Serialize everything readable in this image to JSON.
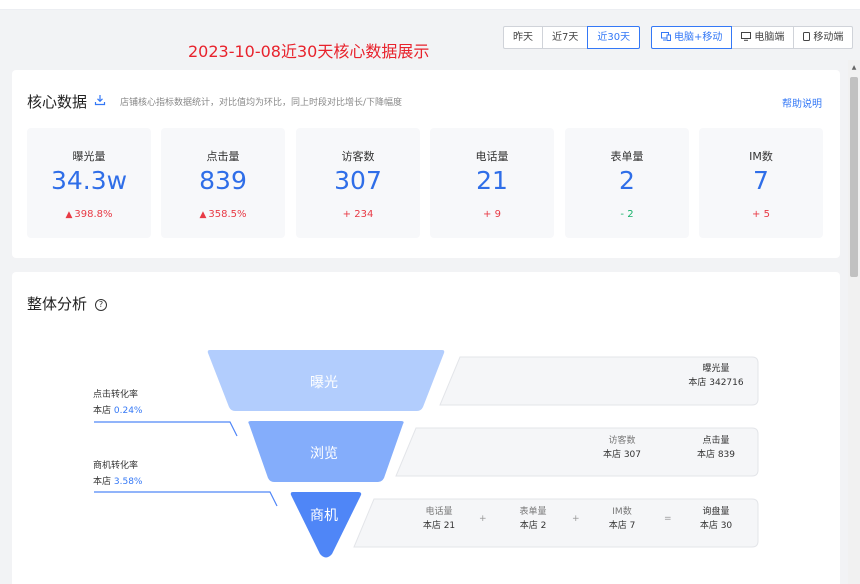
{
  "header": {
    "title": "2023-10-08近30天核心数据展示",
    "time_range": [
      "昨天",
      "近7天",
      "近30天"
    ],
    "time_selected": "近30天",
    "devices": [
      "电脑+移动",
      "电脑端",
      "移动端"
    ],
    "device_selected": "电脑+移动"
  },
  "core": {
    "title": "核心数据",
    "subtitle": "店铺核心指标数据统计，对比值均为环比，同上时段对比增长/下降幅度",
    "help": "帮助说明",
    "metrics": [
      {
        "label": "曝光量",
        "value": "34.3w",
        "delta": "398.8%",
        "arrow": "▲",
        "dir": "up"
      },
      {
        "label": "点击量",
        "value": "839",
        "delta": "358.5%",
        "arrow": "▲",
        "dir": "up"
      },
      {
        "label": "访客数",
        "value": "307",
        "delta": "+ 234",
        "arrow": "",
        "dir": "up"
      },
      {
        "label": "电话量",
        "value": "21",
        "delta": "+ 9",
        "arrow": "",
        "dir": "up"
      },
      {
        "label": "表单量",
        "value": "2",
        "delta": "- 2",
        "arrow": "",
        "dir": "down"
      },
      {
        "label": "IM数",
        "value": "7",
        "delta": "+ 5",
        "arrow": "",
        "dir": "up"
      }
    ]
  },
  "analysis": {
    "title": "整体分析",
    "help_icon": "?",
    "click_rate": {
      "label": "点击转化率",
      "prefix": "本店",
      "value": "0.24%"
    },
    "biz_rate": {
      "label": "商机转化率",
      "prefix": "本店",
      "value": "3.58%"
    },
    "funnel": [
      {
        "stage": "曝光",
        "color": "#b2cdfd"
      },
      {
        "stage": "浏览",
        "color": "#84adfb"
      },
      {
        "stage": "商机",
        "color": "#4f86f7"
      }
    ],
    "row1": [
      {
        "label": "曝光量",
        "value": "本店 342716"
      }
    ],
    "row2": [
      {
        "label": "访客数",
        "value": "本店 307"
      },
      {
        "label": "点击量",
        "value": "本店 839"
      }
    ],
    "row3": [
      {
        "label": "电话量",
        "value": "本店 21"
      },
      {
        "label": "表单量",
        "value": "本店 2"
      },
      {
        "label": "IM数",
        "value": "本店 7"
      },
      {
        "label": "询盘量",
        "value": "本店 30"
      }
    ],
    "ops": [
      "+",
      "+",
      "="
    ]
  },
  "colors": {
    "accent": "#3478f6",
    "title_red": "#e8222c",
    "up": "#e83a45",
    "down": "#17b26a"
  }
}
